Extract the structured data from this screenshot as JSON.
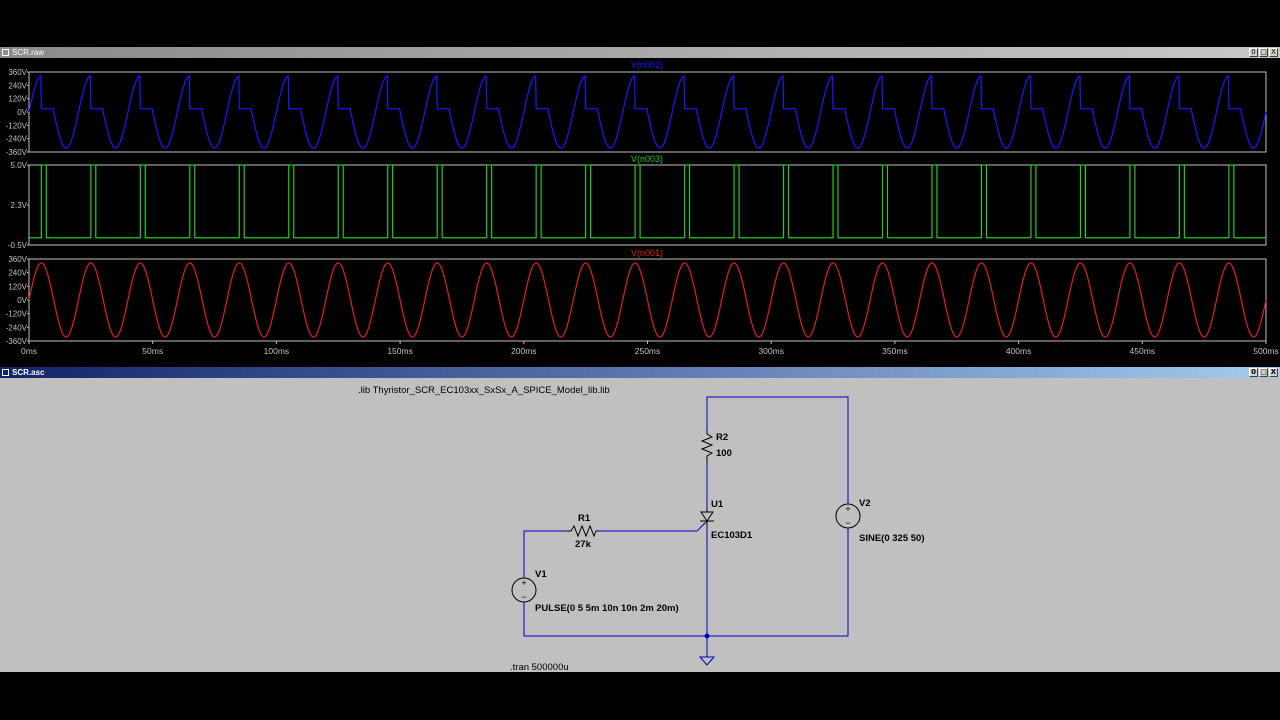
{
  "waveform_window": {
    "title": "SCR.raw",
    "buttons": [
      "0",
      "□",
      "X"
    ],
    "pane_top": {
      "trace": "V(n002)",
      "color": "#1a1aff",
      "yticks": [
        "360V",
        "240V",
        "120V",
        "0V",
        "-120V",
        "-240V",
        "-360V"
      ]
    },
    "pane_mid": {
      "trace": "V(n003)",
      "color": "#22cc22",
      "yticks": [
        "5.0V",
        "2.3V",
        "-0.5V"
      ]
    },
    "pane_bot": {
      "trace": "V(n001)",
      "color": "#e02020",
      "yticks": [
        "360V",
        "240V",
        "120V",
        "0V",
        "-120V",
        "-240V",
        "-360V"
      ]
    },
    "xticks": [
      "0ms",
      "50ms",
      "100ms",
      "150ms",
      "200ms",
      "250ms",
      "300ms",
      "350ms",
      "400ms",
      "450ms",
      "500ms"
    ]
  },
  "schematic_window": {
    "title": "SCR.asc",
    "buttons": [
      "0",
      "□",
      "X"
    ],
    "lib_directive": ".lib Thyristor_SCR_EC103xx_SxSx_A_SPICE_Model_lib.lib",
    "tran_directive": ".tran 500000u",
    "components": {
      "r1": {
        "name": "R1",
        "value": "27k"
      },
      "r2": {
        "name": "R2",
        "value": "100"
      },
      "u1": {
        "name": "U1",
        "value": "EC103D1"
      },
      "v1": {
        "name": "V1",
        "value": "PULSE(0 5 5m 10n 10n 2m 20m)"
      },
      "v2": {
        "name": "V2",
        "value": "SINE(0 325 50)"
      }
    },
    "wire_color": "#0000c0"
  }
}
